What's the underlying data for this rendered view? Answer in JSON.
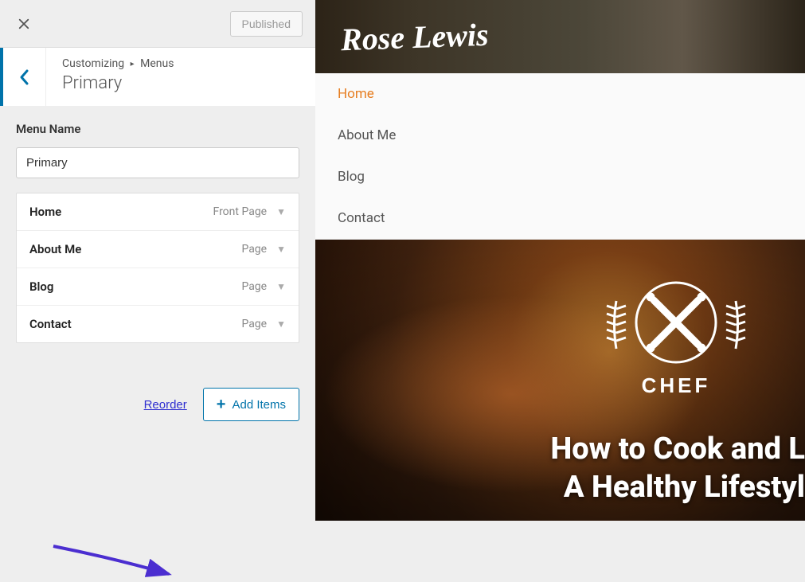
{
  "sidebar": {
    "publish_label": "Published",
    "breadcrumb": {
      "root": "Customizing",
      "section": "Menus"
    },
    "title": "Primary",
    "menu_name_label": "Menu Name",
    "menu_name_value": "Primary",
    "items": [
      {
        "label": "Home",
        "type": "Front Page"
      },
      {
        "label": "About Me",
        "type": "Page"
      },
      {
        "label": "Blog",
        "type": "Page"
      },
      {
        "label": "Contact",
        "type": "Page"
      }
    ],
    "reorder_label": "Reorder",
    "add_items_label": "Add Items"
  },
  "preview": {
    "site_name": "Rose Lewis",
    "nav": [
      {
        "label": "Home",
        "active": true
      },
      {
        "label": "About Me",
        "active": false
      },
      {
        "label": "Blog",
        "active": false
      },
      {
        "label": "Contact",
        "active": false
      }
    ],
    "badge_text": "CHEF",
    "hero_line1": "How to Cook and L",
    "hero_line2": "A Healthy Lifestyl"
  },
  "colors": {
    "accent": "#0073aa",
    "arrow": "#4b2ed0",
    "nav_active": "#e67e22"
  }
}
